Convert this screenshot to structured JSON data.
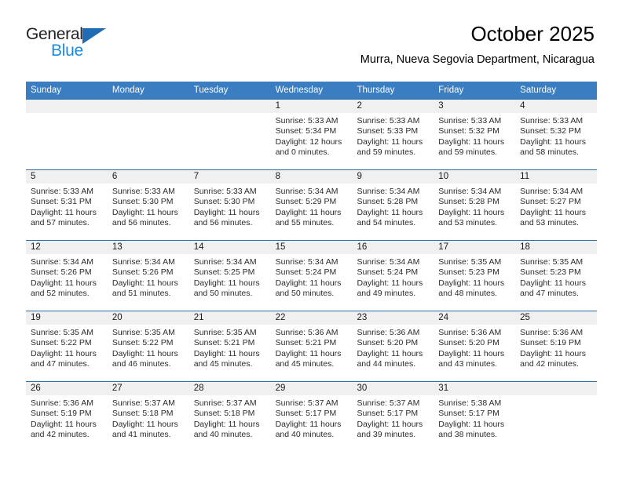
{
  "brand": {
    "name_top": "General",
    "name_bottom": "Blue",
    "accent_blue": "#1f6cb4",
    "light_blue": "#1b8ae0"
  },
  "header": {
    "title": "October 2025",
    "subtitle": "Murra, Nueva Segovia Department, Nicaragua"
  },
  "theme": {
    "header_row_bg": "#3a7dc0",
    "row_divider": "#2e6da4",
    "day_band_bg": "#f0f0f0",
    "cell_bg": "#ffffff"
  },
  "weekday_headers": [
    "Sunday",
    "Monday",
    "Tuesday",
    "Wednesday",
    "Thursday",
    "Friday",
    "Saturday"
  ],
  "weeks": [
    [
      {
        "day": "",
        "sunrise": "",
        "sunset": "",
        "daylight1": "",
        "daylight2": ""
      },
      {
        "day": "",
        "sunrise": "",
        "sunset": "",
        "daylight1": "",
        "daylight2": ""
      },
      {
        "day": "",
        "sunrise": "",
        "sunset": "",
        "daylight1": "",
        "daylight2": ""
      },
      {
        "day": "1",
        "sunrise": "Sunrise: 5:33 AM",
        "sunset": "Sunset: 5:34 PM",
        "daylight1": "Daylight: 12 hours",
        "daylight2": "and 0 minutes."
      },
      {
        "day": "2",
        "sunrise": "Sunrise: 5:33 AM",
        "sunset": "Sunset: 5:33 PM",
        "daylight1": "Daylight: 11 hours",
        "daylight2": "and 59 minutes."
      },
      {
        "day": "3",
        "sunrise": "Sunrise: 5:33 AM",
        "sunset": "Sunset: 5:32 PM",
        "daylight1": "Daylight: 11 hours",
        "daylight2": "and 59 minutes."
      },
      {
        "day": "4",
        "sunrise": "Sunrise: 5:33 AM",
        "sunset": "Sunset: 5:32 PM",
        "daylight1": "Daylight: 11 hours",
        "daylight2": "and 58 minutes."
      }
    ],
    [
      {
        "day": "5",
        "sunrise": "Sunrise: 5:33 AM",
        "sunset": "Sunset: 5:31 PM",
        "daylight1": "Daylight: 11 hours",
        "daylight2": "and 57 minutes."
      },
      {
        "day": "6",
        "sunrise": "Sunrise: 5:33 AM",
        "sunset": "Sunset: 5:30 PM",
        "daylight1": "Daylight: 11 hours",
        "daylight2": "and 56 minutes."
      },
      {
        "day": "7",
        "sunrise": "Sunrise: 5:33 AM",
        "sunset": "Sunset: 5:30 PM",
        "daylight1": "Daylight: 11 hours",
        "daylight2": "and 56 minutes."
      },
      {
        "day": "8",
        "sunrise": "Sunrise: 5:34 AM",
        "sunset": "Sunset: 5:29 PM",
        "daylight1": "Daylight: 11 hours",
        "daylight2": "and 55 minutes."
      },
      {
        "day": "9",
        "sunrise": "Sunrise: 5:34 AM",
        "sunset": "Sunset: 5:28 PM",
        "daylight1": "Daylight: 11 hours",
        "daylight2": "and 54 minutes."
      },
      {
        "day": "10",
        "sunrise": "Sunrise: 5:34 AM",
        "sunset": "Sunset: 5:28 PM",
        "daylight1": "Daylight: 11 hours",
        "daylight2": "and 53 minutes."
      },
      {
        "day": "11",
        "sunrise": "Sunrise: 5:34 AM",
        "sunset": "Sunset: 5:27 PM",
        "daylight1": "Daylight: 11 hours",
        "daylight2": "and 53 minutes."
      }
    ],
    [
      {
        "day": "12",
        "sunrise": "Sunrise: 5:34 AM",
        "sunset": "Sunset: 5:26 PM",
        "daylight1": "Daylight: 11 hours",
        "daylight2": "and 52 minutes."
      },
      {
        "day": "13",
        "sunrise": "Sunrise: 5:34 AM",
        "sunset": "Sunset: 5:26 PM",
        "daylight1": "Daylight: 11 hours",
        "daylight2": "and 51 minutes."
      },
      {
        "day": "14",
        "sunrise": "Sunrise: 5:34 AM",
        "sunset": "Sunset: 5:25 PM",
        "daylight1": "Daylight: 11 hours",
        "daylight2": "and 50 minutes."
      },
      {
        "day": "15",
        "sunrise": "Sunrise: 5:34 AM",
        "sunset": "Sunset: 5:24 PM",
        "daylight1": "Daylight: 11 hours",
        "daylight2": "and 50 minutes."
      },
      {
        "day": "16",
        "sunrise": "Sunrise: 5:34 AM",
        "sunset": "Sunset: 5:24 PM",
        "daylight1": "Daylight: 11 hours",
        "daylight2": "and 49 minutes."
      },
      {
        "day": "17",
        "sunrise": "Sunrise: 5:35 AM",
        "sunset": "Sunset: 5:23 PM",
        "daylight1": "Daylight: 11 hours",
        "daylight2": "and 48 minutes."
      },
      {
        "day": "18",
        "sunrise": "Sunrise: 5:35 AM",
        "sunset": "Sunset: 5:23 PM",
        "daylight1": "Daylight: 11 hours",
        "daylight2": "and 47 minutes."
      }
    ],
    [
      {
        "day": "19",
        "sunrise": "Sunrise: 5:35 AM",
        "sunset": "Sunset: 5:22 PM",
        "daylight1": "Daylight: 11 hours",
        "daylight2": "and 47 minutes."
      },
      {
        "day": "20",
        "sunrise": "Sunrise: 5:35 AM",
        "sunset": "Sunset: 5:22 PM",
        "daylight1": "Daylight: 11 hours",
        "daylight2": "and 46 minutes."
      },
      {
        "day": "21",
        "sunrise": "Sunrise: 5:35 AM",
        "sunset": "Sunset: 5:21 PM",
        "daylight1": "Daylight: 11 hours",
        "daylight2": "and 45 minutes."
      },
      {
        "day": "22",
        "sunrise": "Sunrise: 5:36 AM",
        "sunset": "Sunset: 5:21 PM",
        "daylight1": "Daylight: 11 hours",
        "daylight2": "and 45 minutes."
      },
      {
        "day": "23",
        "sunrise": "Sunrise: 5:36 AM",
        "sunset": "Sunset: 5:20 PM",
        "daylight1": "Daylight: 11 hours",
        "daylight2": "and 44 minutes."
      },
      {
        "day": "24",
        "sunrise": "Sunrise: 5:36 AM",
        "sunset": "Sunset: 5:20 PM",
        "daylight1": "Daylight: 11 hours",
        "daylight2": "and 43 minutes."
      },
      {
        "day": "25",
        "sunrise": "Sunrise: 5:36 AM",
        "sunset": "Sunset: 5:19 PM",
        "daylight1": "Daylight: 11 hours",
        "daylight2": "and 42 minutes."
      }
    ],
    [
      {
        "day": "26",
        "sunrise": "Sunrise: 5:36 AM",
        "sunset": "Sunset: 5:19 PM",
        "daylight1": "Daylight: 11 hours",
        "daylight2": "and 42 minutes."
      },
      {
        "day": "27",
        "sunrise": "Sunrise: 5:37 AM",
        "sunset": "Sunset: 5:18 PM",
        "daylight1": "Daylight: 11 hours",
        "daylight2": "and 41 minutes."
      },
      {
        "day": "28",
        "sunrise": "Sunrise: 5:37 AM",
        "sunset": "Sunset: 5:18 PM",
        "daylight1": "Daylight: 11 hours",
        "daylight2": "and 40 minutes."
      },
      {
        "day": "29",
        "sunrise": "Sunrise: 5:37 AM",
        "sunset": "Sunset: 5:17 PM",
        "daylight1": "Daylight: 11 hours",
        "daylight2": "and 40 minutes."
      },
      {
        "day": "30",
        "sunrise": "Sunrise: 5:37 AM",
        "sunset": "Sunset: 5:17 PM",
        "daylight1": "Daylight: 11 hours",
        "daylight2": "and 39 minutes."
      },
      {
        "day": "31",
        "sunrise": "Sunrise: 5:38 AM",
        "sunset": "Sunset: 5:17 PM",
        "daylight1": "Daylight: 11 hours",
        "daylight2": "and 38 minutes."
      },
      {
        "day": "",
        "sunrise": "",
        "sunset": "",
        "daylight1": "",
        "daylight2": ""
      }
    ]
  ]
}
